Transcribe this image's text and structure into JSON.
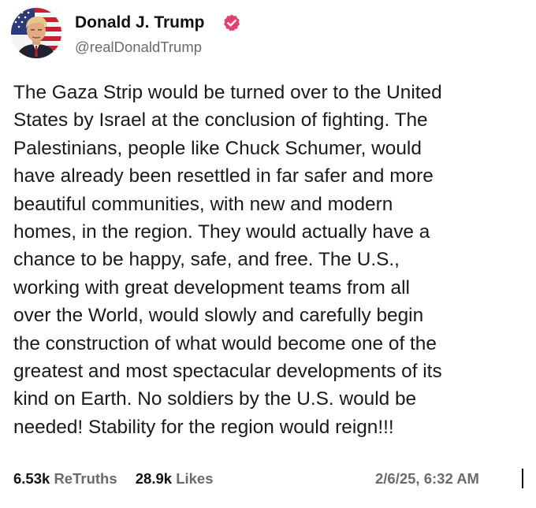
{
  "author": {
    "display_name": "Donald J. Trump",
    "handle": "@realDonaldTrump",
    "verified_icon": "verified-badge-icon",
    "verified_color": "#e63e6d",
    "avatar_icon": "avatar-portrait-flag"
  },
  "post": {
    "lines": [
      "The Gaza Strip would be turned over to the United",
      "States by Israel at the conclusion of fighting. The",
      "Palestinians, people like Chuck Schumer, would",
      "have already been resettled in far safer and more",
      "beautiful communities, with new and modern",
      "homes, in the region. They would actually have a",
      "chance to be happy, safe, and free. The U.S.,",
      "working with great development teams from all",
      "over the World, would slowly and carefully begin",
      "the construction of what would become one of the",
      "greatest and most spectacular developments of its",
      "kind on Earth. No soldiers by the U.S. would be",
      "needed! Stability for the region would reign!!!"
    ]
  },
  "stats": {
    "retruths_count": "6.53k",
    "retruths_label": "ReTruths",
    "likes_count": "28.9k",
    "likes_label": "Likes",
    "timestamp": "2/6/25, 6:32 AM"
  }
}
